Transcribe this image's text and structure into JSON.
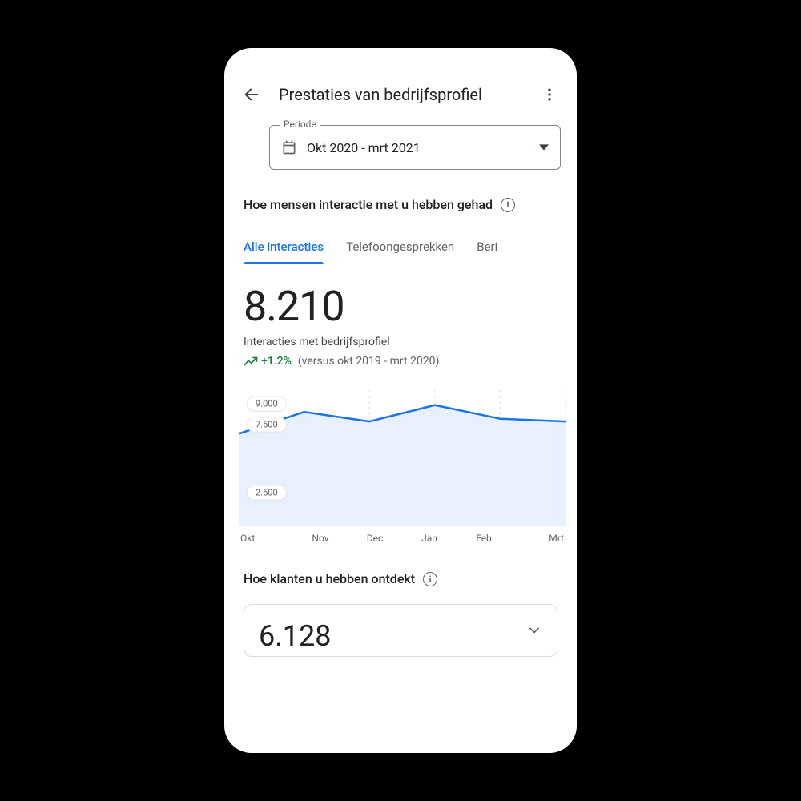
{
  "header": {
    "title": "Prestaties van bedrijfsprofiel"
  },
  "period": {
    "label": "Periode",
    "value": "Okt 2020 - mrt 2021"
  },
  "interactions": {
    "section_title": "Hoe mensen interactie met u hebben gehad",
    "tabs": [
      "Alle interacties",
      "Telefoongesprekken",
      "Beri"
    ],
    "big_value": "8.210",
    "metric_label": "Interacties met bedrijfsprofiel",
    "delta_pct": "+1.2%",
    "delta_compare": "(versus okt 2019 - mrt 2020)"
  },
  "discovery": {
    "section_title": "Hoe klanten u hebben ontdekt",
    "big_value": "6.128"
  },
  "chart_data": {
    "type": "area",
    "title": "Interacties met bedrijfsprofiel",
    "categories": [
      "Okt",
      "Nov",
      "Dec",
      "Jan",
      "Feb",
      "Mrt"
    ],
    "values": [
      6800,
      8400,
      7700,
      8900,
      7900,
      7700
    ],
    "y_ticks": [
      "9.000",
      "7.500",
      "2.500"
    ],
    "ylim": [
      0,
      10000
    ],
    "ylabel": "",
    "xlabel": ""
  }
}
